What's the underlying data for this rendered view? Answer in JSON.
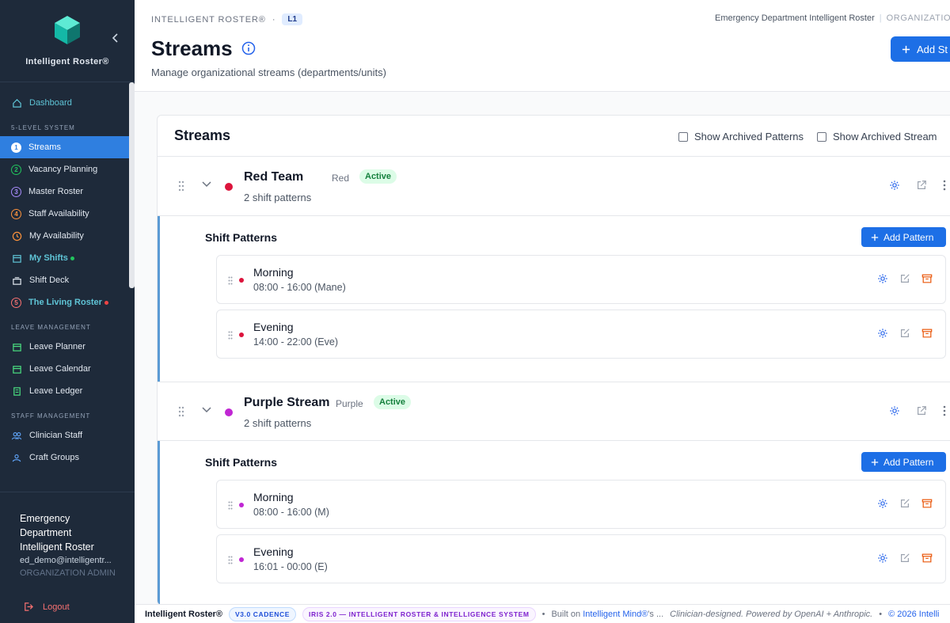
{
  "app": {
    "brand_name": "Intelligent Roster®",
    "breadcrumb_root": "INTELLIGENT ROSTER®",
    "breadcrumb_level": "L1",
    "org_name": "Emergency Department Intelligent Roster",
    "org_role": "ORGANIZATION"
  },
  "sidebar": {
    "dashboard": "Dashboard",
    "section_5level": "5-LEVEL SYSTEM",
    "level_items": [
      {
        "num": "1",
        "label": "Streams",
        "num_color": "#2f7fe0"
      },
      {
        "num": "2",
        "label": "Vacancy Planning",
        "num_color": "#22c55e"
      },
      {
        "num": "3",
        "label": "Master Roster",
        "num_color": "#a78bfa"
      },
      {
        "num": "4",
        "label": "Staff Availability",
        "num_color": "#fb923c"
      },
      {
        "num": "5",
        "label": "The Living Roster",
        "num_color": "#f87171"
      }
    ],
    "my_availability": "My Availability",
    "my_shifts": "My Shifts",
    "shift_deck": "Shift Deck",
    "section_leave": "LEAVE MANAGEMENT",
    "leave_items": [
      "Leave Planner",
      "Leave Calendar",
      "Leave Ledger"
    ],
    "section_staff": "STAFF MANAGEMENT",
    "staff_items": [
      "Clinician Staff",
      "Craft Groups"
    ],
    "footer": {
      "org_name": "Emergency Department Intelligent Roster",
      "email": "ed_demo@intelligentr...",
      "role": "ORGANIZATION ADMIN",
      "logout": "Logout"
    }
  },
  "header": {
    "title": "Streams",
    "subtitle": "Manage organizational streams (departments/units)",
    "add_button": "Add St"
  },
  "card": {
    "title": "Streams",
    "show_archived_patterns": "Show Archived Patterns",
    "show_archived_streams": "Show Archived Stream"
  },
  "streams": [
    {
      "name": "Red Team",
      "color_name": "Red",
      "color": "#dc143c",
      "status": "Active",
      "pattern_count": "2 shift patterns",
      "section_title": "Shift Patterns",
      "add_pattern": "Add Pattern",
      "patterns": [
        {
          "name": "Morning",
          "time": "08:00 - 16:00 (Mane)"
        },
        {
          "name": "Evening",
          "time": "14:00 - 22:00 (Eve)"
        }
      ]
    },
    {
      "name": "Purple Stream",
      "color_name": "Purple",
      "color": "#c026d3",
      "status": "Active",
      "pattern_count": "2 shift patterns",
      "section_title": "Shift Patterns",
      "add_pattern": "Add Pattern",
      "patterns": [
        {
          "name": "Morning",
          "time": "08:00 - 16:00 (M)"
        },
        {
          "name": "Evening",
          "time": "16:01 - 00:00 (E)"
        }
      ]
    }
  ],
  "footer": {
    "brand": "Intelligent Roster®",
    "version_pill": "V3.0 CADENCE",
    "iris_pill": "IRIS 2.0 — INTELLIGENT ROSTER & INTELLIGENCE SYSTEM",
    "built_on": "Built on",
    "built_link": "Intelligent Mind®",
    "built_suffix": "'s ...",
    "tagline": "Clinician-designed. Powered by OpenAI + Anthropic.",
    "copyright": "© 2026 Intelli"
  },
  "colors": {
    "accent": "#2f7fe0",
    "sidebar_bg": "#1e2a3a",
    "primary_button": "#1d6fe6",
    "active_badge_bg": "#dcfce7"
  }
}
